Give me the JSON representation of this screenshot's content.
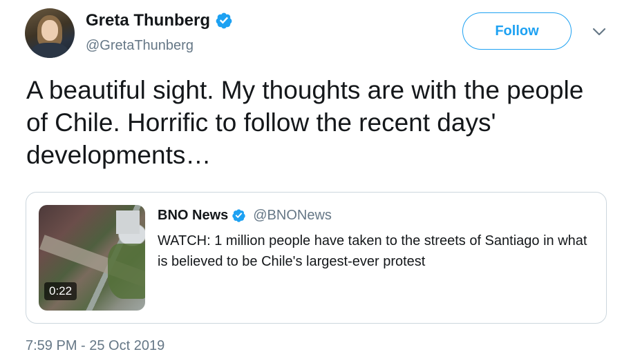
{
  "author": {
    "display_name": "Greta Thunberg",
    "handle": "@GretaThunberg",
    "verified": true
  },
  "actions": {
    "follow_label": "Follow"
  },
  "tweet": {
    "text": "A beautiful sight. My thoughts are with the people of Chile. Horrific to follow the recent days' developments…",
    "timestamp": "7:59 PM - 25 Oct 2019"
  },
  "quoted": {
    "display_name": "BNO News",
    "handle": "@BNONews",
    "verified": true,
    "text": "WATCH: 1 million people have taken to the streets of Santiago in what is believed to be Chile's largest-ever protest",
    "media": {
      "duration": "0:22"
    }
  },
  "colors": {
    "accent": "#1da1f2",
    "secondary_text": "#657786",
    "border": "#ccd6dd"
  },
  "icons": {
    "verified": "verified-badge-icon",
    "caret": "chevron-down-icon"
  }
}
